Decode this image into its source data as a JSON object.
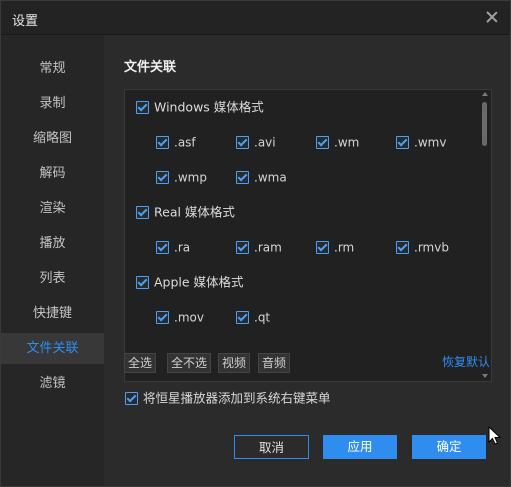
{
  "window": {
    "title": "设置"
  },
  "sidebar": {
    "items": [
      {
        "label": "常规"
      },
      {
        "label": "录制"
      },
      {
        "label": "缩略图"
      },
      {
        "label": "解码"
      },
      {
        "label": "渲染"
      },
      {
        "label": "播放"
      },
      {
        "label": "列表"
      },
      {
        "label": "快捷键"
      },
      {
        "label": "文件关联",
        "active": true
      },
      {
        "label": "滤镜"
      }
    ]
  },
  "main": {
    "section_title": "文件关联",
    "groups": [
      {
        "label": "Windows 媒体格式",
        "checked": true,
        "items": [
          ".asf",
          ".avi",
          ".wm",
          ".wmv",
          ".wmp",
          ".wma"
        ]
      },
      {
        "label": "Real 媒体格式",
        "checked": true,
        "items": [
          ".ra",
          ".ram",
          ".rm",
          ".rmvb"
        ]
      },
      {
        "label": "Apple 媒体格式",
        "checked": true,
        "items": [
          ".mov",
          ".qt"
        ]
      }
    ],
    "select_all": "全选",
    "select_none": "全不选",
    "video": "视频",
    "audio": "音频",
    "restore_default": "恢复默认",
    "context_menu_label": "将恒星播放器添加到系统右键菜单",
    "context_menu_checked": true
  },
  "footer": {
    "cancel": "取消",
    "apply": "应用",
    "ok": "确定"
  },
  "colors": {
    "accent": "#2f8df0",
    "background": "#2b2b2b",
    "sidebar_bg": "#262626"
  },
  "icons": {
    "close": "close-icon",
    "checkbox": "checkmark-icon",
    "cursor": "mouse-pointer-icon"
  }
}
